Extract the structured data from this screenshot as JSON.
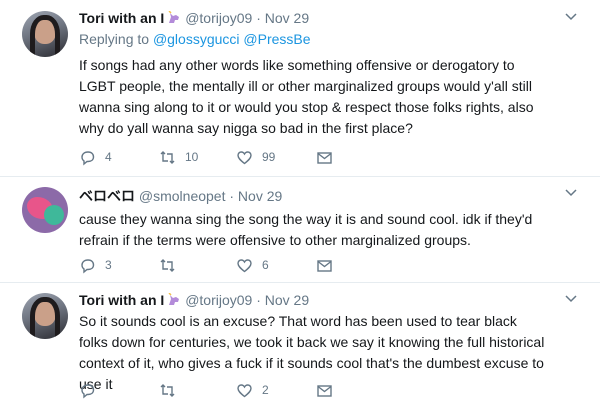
{
  "tweets": [
    {
      "display_name": "Tori with an I",
      "handle": "@torijoy09",
      "time": "· Nov 29",
      "replying_prefix": "Replying to",
      "replying_handles": "@glossygucci @PressBe",
      "text": "If songs had any other words like something offensive or derogatory to LGBT people, the mentally ill or other marginalized groups would y'all still wanna sing along to it or would you stop & respect those folks rights, also why do yall wanna say nigga so bad in the first place?",
      "replies": "4",
      "retweets": "10",
      "likes": "99"
    },
    {
      "display_name": "ベロベロ",
      "handle": "@smolneopet",
      "time": "· Nov 29",
      "text": "cause they wanna sing the song the way it is and sound cool. idk if they'd refrain if the terms were offensive to other marginalized groups.",
      "replies": "3",
      "retweets": "",
      "likes": "6"
    },
    {
      "display_name": "Tori with an I",
      "handle": "@torijoy09",
      "time": "· Nov 29",
      "text": "So it sounds cool is an excuse? That word has been used to tear black folks down for centuries, we took it back we say it knowing the full historical context of it, who gives a fuck if it sounds cool that's the dumbest excuse to use it",
      "replies": "",
      "retweets": "",
      "likes": "2"
    }
  ],
  "icons": {
    "reply": "reply-icon",
    "retweet": "retweet-icon",
    "like": "heart-icon",
    "dm": "envelope-icon",
    "more": "chevron-down-icon",
    "badge": "unicorn-emoji-icon"
  },
  "colors": {
    "link": "#1b95e0",
    "meta": "#657786",
    "text": "#14171a"
  }
}
